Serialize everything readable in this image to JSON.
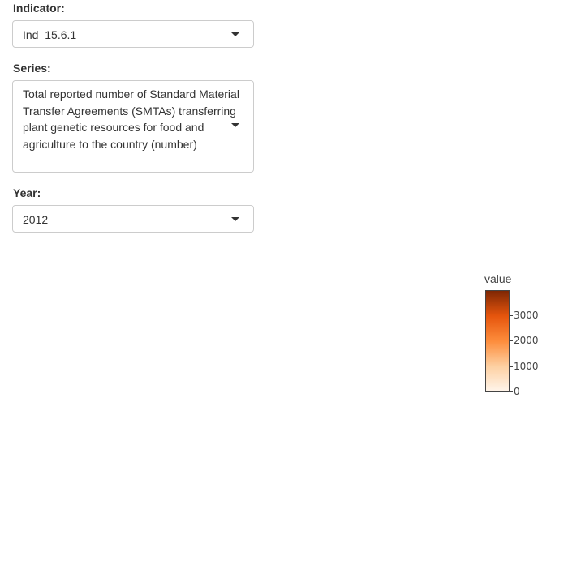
{
  "filters": {
    "indicator": {
      "label": "Indicator:",
      "value": "Ind_15.6.1"
    },
    "series": {
      "label": "Series:",
      "value": "Total reported number of Standard Material Transfer Agreements (SMTAs) transferring plant genetic resources for food and agriculture to the country (number)"
    },
    "year": {
      "label": "Year:",
      "value": "2012"
    }
  },
  "legend": {
    "title": "value",
    "ticks": [
      {
        "label": "3000",
        "value": 3000
      },
      {
        "label": "2000",
        "value": 2000
      },
      {
        "label": "1000",
        "value": 1000
      },
      {
        "label": "0",
        "value": 0
      }
    ],
    "min": 0,
    "max": 3950,
    "colors": [
      "#fff5eb",
      "#fdd0a2",
      "#fd8d3c",
      "#e6550d",
      "#7f2704"
    ]
  },
  "icons": {
    "dropdown": "caret-down-icon"
  }
}
